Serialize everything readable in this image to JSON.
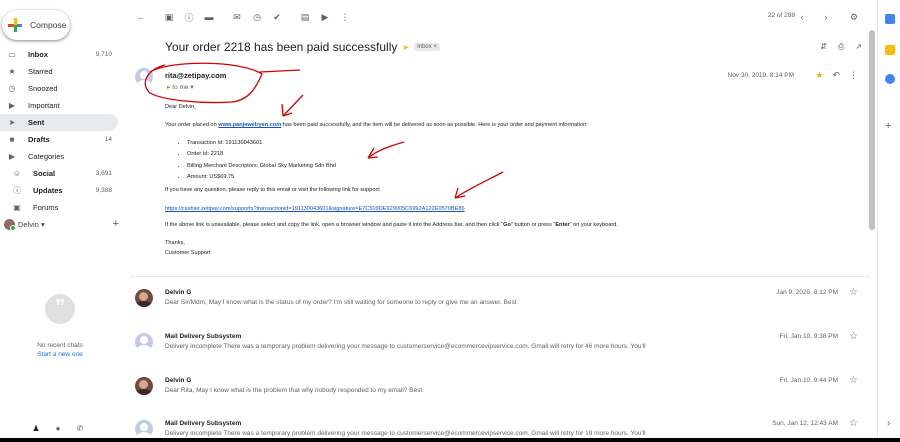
{
  "sidebar": {
    "compose_label": "Compose",
    "items": [
      {
        "icon": "inbox-icon",
        "glyph": "▭",
        "label": "Inbox",
        "count": "9,710"
      },
      {
        "icon": "star-icon",
        "glyph": "★",
        "label": "Starred",
        "count": ""
      },
      {
        "icon": "snooze-icon",
        "glyph": "◷",
        "label": "Snoozed",
        "count": ""
      },
      {
        "icon": "important-icon",
        "glyph": "▶",
        "label": "Important",
        "count": ""
      },
      {
        "icon": "send-icon",
        "glyph": "➤",
        "label": "Sent",
        "count": ""
      },
      {
        "icon": "draft-icon",
        "glyph": "■",
        "label": "Drafts",
        "count": "14"
      },
      {
        "icon": "label-icon",
        "glyph": "▶",
        "label": "Categories",
        "count": ""
      },
      {
        "icon": "social-icon",
        "glyph": "☺",
        "label": "Social",
        "count": "3,691"
      },
      {
        "icon": "info-icon",
        "glyph": "ⓘ",
        "label": "Updates",
        "count": "9,388"
      },
      {
        "icon": "forum-icon",
        "glyph": "▣",
        "label": "Forums",
        "count": ""
      }
    ],
    "user_name": "Delvin",
    "user_caret": "▾",
    "no_chats": "No recent chats",
    "start_chat": "Start a new one"
  },
  "toolbar": {
    "pager": "22 of 288"
  },
  "subject": {
    "title": "Your order 2218 has been paid successfully",
    "badge": "Inbox ×"
  },
  "message": {
    "from": "rita@zetipay.com",
    "to": "to me ▾",
    "date": "Nov 30, 2019, 8:14 PM",
    "greeting": "Dear Delvin,",
    "intro_before": "Your order placed on ",
    "intro_link": "www.panjewelryen.com",
    "intro_after": " has been paid successfully, and the item will be delivered as soon as possible. Here is your order and payment information:",
    "bullets": [
      "Transaction Id: 191130043601",
      "Order Id: 2218",
      "Billing Merchant Descriptors: Global Sky Marketing Sdn Bhd",
      "Amount: US$69.75"
    ],
    "support_text": "If you have any question, please reply to this email or visit the following link for support:",
    "support_link": "https://cashier.zetipay.com/supports?transactionid=191130043601&signature=E7C509DE929005C6992A122E0570BE86",
    "copy_before": "If the above link is unavailable, please select and copy the link, open a browser window and paste it into the Address bar, and then click \"",
    "copy_go": "Go",
    "copy_mid": "\" button or press \"",
    "copy_enter": "Enter",
    "copy_after": "\" on your keyboard.",
    "thanks": "Thanks,",
    "signoff": "Customer Support"
  },
  "threads": [
    {
      "name": "Delvin G",
      "snippet": "Dear Sir/Mdm, May I know what is the status of my order? I'm still waiting for someone to reply or give me an answer. Best",
      "date": "Jan 9, 2020, 8:12 PM",
      "avatar": "person"
    },
    {
      "name": "Mail Delivery Subsystem",
      "snippet": "Delivery incomplete There was a temporary problem delivering your message to customerservice@ecommercevipservice.com. Gmail will retry for 46 more hours. You'll",
      "date": "Fri, Jan 10, 9:38 PM",
      "avatar": "sys"
    },
    {
      "name": "Delvin G",
      "snippet": "Dear Rita, May I know what is the problem that why nobody responded to my email? Best",
      "date": "Fri, Jan 10, 9:44 PM",
      "avatar": "person"
    },
    {
      "name": "Mail Delivery Subsystem",
      "snippet": "Delivery incomplete There was a temporary problem delivering your message to customerservice@ecommercevipservice.com. Gmail will retry for 19 more hours. You'll",
      "date": "Sun, Jan 12, 12:43 AM",
      "avatar": "sys"
    }
  ],
  "colors": {
    "accent": "#1a73e8",
    "annotation": "#d50000",
    "star": "#f4b400"
  }
}
